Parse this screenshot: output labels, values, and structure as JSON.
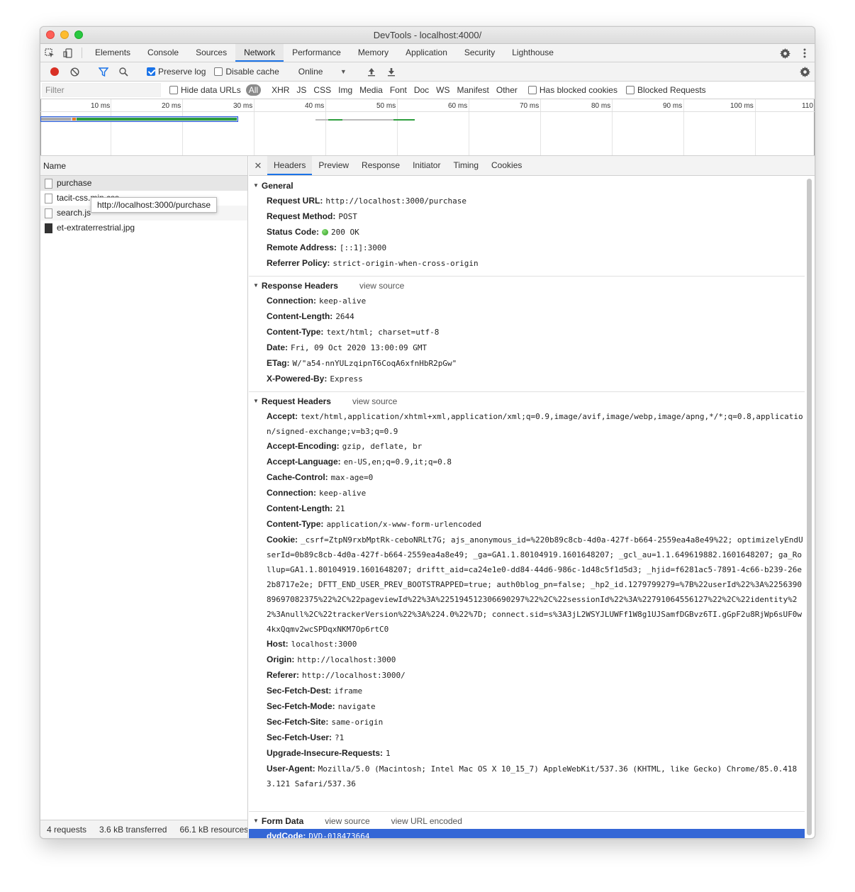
{
  "window": {
    "title": "DevTools - localhost:4000/"
  },
  "tabs": [
    "Elements",
    "Console",
    "Sources",
    "Network",
    "Performance",
    "Memory",
    "Application",
    "Security",
    "Lighthouse"
  ],
  "toolbar": {
    "preserve_log": "Preserve log",
    "disable_cache": "Disable cache",
    "throttle": "Online"
  },
  "filter": {
    "placeholder": "Filter",
    "hide_data_urls": "Hide data URLs",
    "types": [
      "All",
      "XHR",
      "JS",
      "CSS",
      "Img",
      "Media",
      "Font",
      "Doc",
      "WS",
      "Manifest",
      "Other"
    ],
    "has_blocked_cookies": "Has blocked cookies",
    "blocked_requests": "Blocked Requests"
  },
  "overview": {
    "ticks": [
      "10 ms",
      "20 ms",
      "30 ms",
      "40 ms",
      "50 ms",
      "60 ms",
      "70 ms",
      "80 ms",
      "90 ms",
      "100 ms",
      "110"
    ]
  },
  "requests": {
    "header": "Name",
    "items": [
      "purchase",
      "tacit-css.min.css",
      "search.js",
      "et-extraterrestrial.jpg"
    ],
    "tooltip": "http://localhost:3000/purchase"
  },
  "status": {
    "requests": "4 requests",
    "transferred": "3.6 kB transferred",
    "resources": "66.1 kB resources"
  },
  "detail_tabs": [
    "Headers",
    "Preview",
    "Response",
    "Initiator",
    "Timing",
    "Cookies"
  ],
  "general": {
    "title": "General",
    "rows": [
      {
        "k": "Request URL:",
        "v": "http://localhost:3000/purchase"
      },
      {
        "k": "Request Method:",
        "v": "POST"
      },
      {
        "k": "Status Code:",
        "v": "200 OK"
      },
      {
        "k": "Remote Address:",
        "v": "[::1]:3000"
      },
      {
        "k": "Referrer Policy:",
        "v": "strict-origin-when-cross-origin"
      }
    ]
  },
  "response_headers": {
    "title": "Response Headers",
    "view_source": "view source",
    "rows": [
      {
        "k": "Connection:",
        "v": "keep-alive"
      },
      {
        "k": "Content-Length:",
        "v": "2644"
      },
      {
        "k": "Content-Type:",
        "v": "text/html; charset=utf-8"
      },
      {
        "k": "Date:",
        "v": "Fri, 09 Oct 2020 13:00:09 GMT"
      },
      {
        "k": "ETag:",
        "v": "W/\"a54-nnYULzqipnT6CoqA6xfnHbR2pGw\""
      },
      {
        "k": "X-Powered-By:",
        "v": "Express"
      }
    ]
  },
  "request_headers": {
    "title": "Request Headers",
    "view_source": "view source",
    "rows": [
      {
        "k": "Accept:",
        "v": "text/html,application/xhtml+xml,application/xml;q=0.9,image/avif,image/webp,image/apng,*/*;q=0.8,application/signed-exchange;v=b3;q=0.9"
      },
      {
        "k": "Accept-Encoding:",
        "v": "gzip, deflate, br"
      },
      {
        "k": "Accept-Language:",
        "v": "en-US,en;q=0.9,it;q=0.8"
      },
      {
        "k": "Cache-Control:",
        "v": "max-age=0"
      },
      {
        "k": "Connection:",
        "v": "keep-alive"
      },
      {
        "k": "Content-Length:",
        "v": "21"
      },
      {
        "k": "Content-Type:",
        "v": "application/x-www-form-urlencoded"
      },
      {
        "k": "Cookie:",
        "v": "_csrf=ZtpN9rxbMptRk-ceboNRLt7G; ajs_anonymous_id=%220b89c8cb-4d0a-427f-b664-2559ea4a8e49%22; optimizelyEndUserId=0b89c8cb-4d0a-427f-b664-2559ea4a8e49; _ga=GA1.1.80104919.1601648207; _gcl_au=1.1.649619882.1601648207; ga_Rollup=GA1.1.80104919.1601648207; driftt_aid=ca24e1e0-dd84-44d6-986c-1d48c5f1d5d3; _hjid=f6281ac5-7891-4c66-b239-26e2b8717e2e; DFTT_END_USER_PREV_BOOTSTRAPPED=true; auth0blog_pn=false; _hp2_id.1279799279=%7B%22userId%22%3A%225639089697082375%22%2C%22pageviewId%22%3A%225194512306690297%22%2C%22sessionId%22%3A%22791064556127%22%2C%22identity%22%3Anull%2C%22trackerVersion%22%3A%224.0%22%7D; connect.sid=s%3A3jL2WSYJLUWFf1W8g1UJSamfDGBvz6TI.gGpF2u8RjWp6sUF0w4kxQqmv2wcSPDqxNKM7Op6rtC0"
      },
      {
        "k": "Host:",
        "v": "localhost:3000"
      },
      {
        "k": "Origin:",
        "v": "http://localhost:3000"
      },
      {
        "k": "Referer:",
        "v": "http://localhost:3000/"
      },
      {
        "k": "Sec-Fetch-Dest:",
        "v": "iframe"
      },
      {
        "k": "Sec-Fetch-Mode:",
        "v": "navigate"
      },
      {
        "k": "Sec-Fetch-Site:",
        "v": "same-origin"
      },
      {
        "k": "Sec-Fetch-User:",
        "v": "?1"
      },
      {
        "k": "Upgrade-Insecure-Requests:",
        "v": "1"
      },
      {
        "k": "User-Agent:",
        "v": "Mozilla/5.0 (Macintosh; Intel Mac OS X 10_15_7) AppleWebKit/537.36 (KHTML, like Gecko) Chrome/85.0.4183.121 Safari/537.36"
      }
    ]
  },
  "form_data": {
    "title": "Form Data",
    "view_source": "view source",
    "view_url_encoded": "view URL encoded",
    "rows": [
      {
        "k": "dvdCode:",
        "v": "DVD-018473664"
      }
    ]
  },
  "colors": {
    "accent": "#1a73e8",
    "record": "#d93025",
    "selection": "#3467d6"
  }
}
